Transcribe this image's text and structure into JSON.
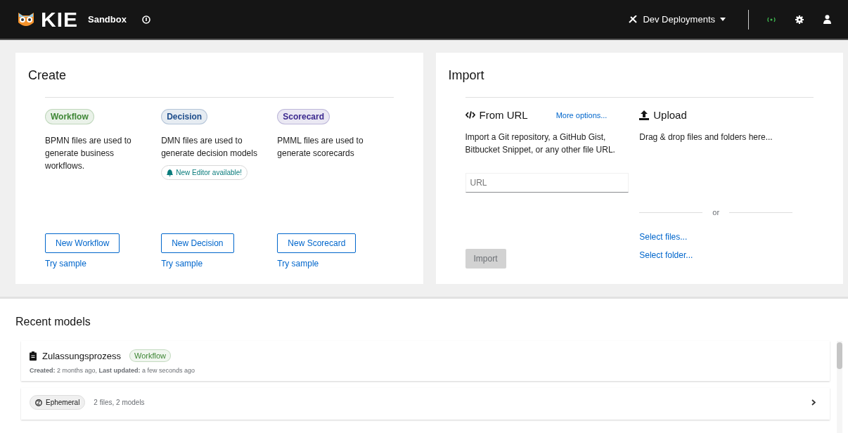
{
  "header": {
    "brand": "KIE",
    "product": "Sandbox",
    "deployments": "Dev Deployments"
  },
  "create": {
    "title": "Create",
    "items": [
      {
        "tag": "Workflow",
        "color": "#3e8635",
        "description": "BPMN files are used to generate business workflows.",
        "button": "New Workflow",
        "link": "Try sample"
      },
      {
        "tag": "Decision",
        "color": "#1f4e8c",
        "description": "DMN files are used to generate decision models",
        "notice": "New Editor available!",
        "button": "New Decision",
        "link": "Try sample"
      },
      {
        "tag": "Scorecard",
        "color": "#3c2a8f",
        "description": "PMML files are used to generate scorecards",
        "button": "New Scorecard",
        "link": "Try sample"
      }
    ]
  },
  "import": {
    "title": "Import",
    "from_url": {
      "title": "From URL",
      "more": "More options...",
      "description": "Import a Git repository, a GitHub Gist, Bitbucket Snippet, or any other file URL.",
      "placeholder": "URL",
      "button": "Import",
      "disabled": true
    },
    "upload": {
      "title": "Upload",
      "description": "Drag & drop files and folders here...",
      "separator": "or",
      "links": [
        "Select files...",
        "Select folder..."
      ]
    }
  },
  "recent": {
    "title": "Recent models",
    "items": [
      {
        "kind": "model",
        "name": "Zulassungsprozess",
        "tag": "Workflow",
        "color": "#3e8635",
        "meta": "**Created:** 2 months ago, **Last updated:** a few seconds ago"
      },
      {
        "kind": "workspace",
        "tag": "Ephemeral",
        "meta": "2 files, 2 models"
      }
    ]
  }
}
